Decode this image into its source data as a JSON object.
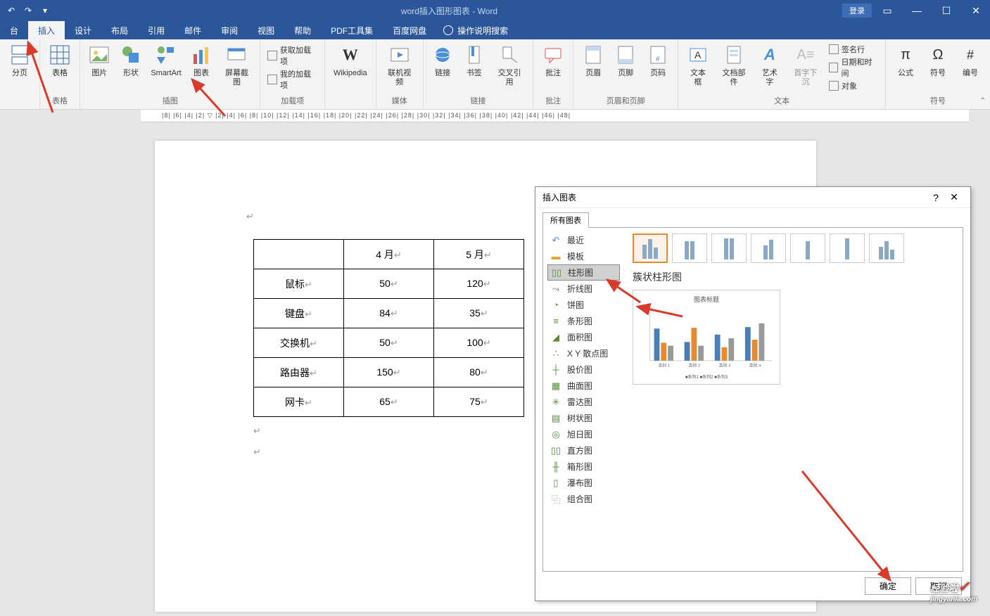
{
  "title": "word插入图形图表 - Word",
  "login": "登录",
  "tabs": [
    "台",
    "插入",
    "设计",
    "布局",
    "引用",
    "邮件",
    "审阅",
    "视图",
    "帮助",
    "PDF工具集",
    "百度网盘"
  ],
  "active_tab": 1,
  "tell_me": "操作说明搜索",
  "ribbon_groups": [
    {
      "label": "",
      "items": [
        {
          "cap": "分页"
        }
      ]
    },
    {
      "label": "表格",
      "items": [
        {
          "cap": "表格"
        }
      ]
    },
    {
      "label": "插图",
      "items": [
        {
          "cap": "图片"
        },
        {
          "cap": "形状"
        },
        {
          "cap": "SmartArt"
        },
        {
          "cap": "图表"
        },
        {
          "cap": "屏幕截图"
        }
      ]
    },
    {
      "label": "加载项",
      "items": [],
      "vitems": [
        "获取加载项",
        "我的加载项"
      ]
    },
    {
      "label": "",
      "items": [
        {
          "cap": "Wikipedia"
        }
      ]
    },
    {
      "label": "媒体",
      "items": [
        {
          "cap": "联机视频"
        }
      ]
    },
    {
      "label": "链接",
      "items": [
        {
          "cap": "链接"
        },
        {
          "cap": "书签"
        },
        {
          "cap": "交叉引用"
        }
      ]
    },
    {
      "label": "批注",
      "items": [
        {
          "cap": "批注"
        }
      ]
    },
    {
      "label": "页眉和页脚",
      "items": [
        {
          "cap": "页眉"
        },
        {
          "cap": "页脚"
        },
        {
          "cap": "页码"
        }
      ]
    },
    {
      "label": "文本",
      "items": [
        {
          "cap": "文本框"
        },
        {
          "cap": "文档部件"
        },
        {
          "cap": "艺术字"
        },
        {
          "cap": "首字下沉"
        }
      ],
      "vitems": [
        "签名行",
        "日期和时间",
        "对象"
      ]
    },
    {
      "label": "符号",
      "items": [
        {
          "cap": "公式"
        },
        {
          "cap": "符号"
        },
        {
          "cap": "编号"
        }
      ]
    }
  ],
  "ruler": "|8|  |6|  |4|  |2|  ▽  |2|  |4|  |6|  |8|  |10|  |12|  |14|  |16|  |18|  |20|  |22|  |24|  |26|  |28|  |30|  |32|  |34|  |36|  |38|  |40|  |42|  |44|  |46|  |48|",
  "table": {
    "headers": [
      "",
      "4 月",
      "5 月"
    ],
    "rows": [
      [
        "鼠标",
        "50",
        "120"
      ],
      [
        "键盘",
        "84",
        "35"
      ],
      [
        "交换机",
        "50",
        "100"
      ],
      [
        "路由器",
        "150",
        "80"
      ],
      [
        "网卡",
        "65",
        "75"
      ]
    ]
  },
  "dialog": {
    "title": "插入图表",
    "tab": "所有图表",
    "categories": [
      "最近",
      "模板",
      "柱形图",
      "折线图",
      "饼图",
      "条形图",
      "面积图",
      "X Y 散点图",
      "股价图",
      "曲面图",
      "雷达图",
      "树状图",
      "旭日图",
      "直方图",
      "箱形图",
      "瀑布图",
      "组合图"
    ],
    "selected_cat": 2,
    "subtype_title": "簇状柱形图",
    "preview_title": "图表标题",
    "preview_cats": [
      "类别 1",
      "类别 2",
      "类别 3",
      "类别 4"
    ],
    "preview_legend": "■系列1 ■系列2 ■系列3",
    "ok": "确定",
    "cancel": "取消"
  },
  "chart_data": {
    "type": "bar",
    "title": "图表标题",
    "categories": [
      "类别 1",
      "类别 2",
      "类别 3",
      "类别 4"
    ],
    "series": [
      {
        "name": "系列1",
        "values": [
          4.3,
          2.5,
          3.5,
          4.5
        ]
      },
      {
        "name": "系列2",
        "values": [
          2.4,
          4.4,
          1.8,
          2.8
        ]
      },
      {
        "name": "系列3",
        "values": [
          2.0,
          2.0,
          3.0,
          5.0
        ]
      }
    ],
    "ylim": [
      0,
      6
    ]
  },
  "watermark": {
    "brand": "经验啦",
    "url": "jingyanla.com"
  }
}
